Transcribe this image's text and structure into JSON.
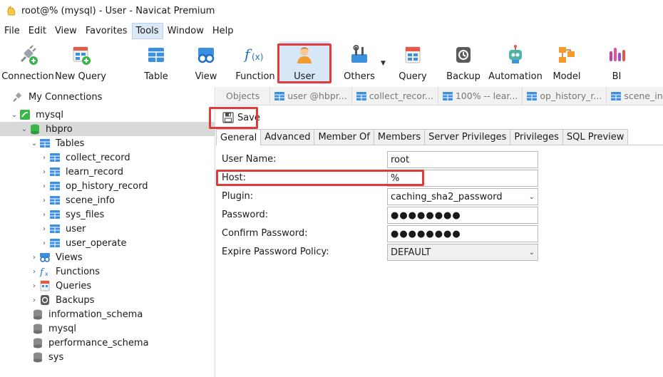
{
  "window": {
    "title": "root@% (mysql) - User - Navicat Premium"
  },
  "menu": [
    "File",
    "Edit",
    "View",
    "Favorites",
    "Tools",
    "Window",
    "Help"
  ],
  "menu_active": "Tools",
  "toolbar": {
    "connection": "Connection",
    "new_query": "New Query",
    "table": "Table",
    "view": "View",
    "function": "Function",
    "user": "User",
    "others": "Others",
    "query": "Query",
    "backup": "Backup",
    "automation": "Automation",
    "model": "Model",
    "bi": "BI"
  },
  "sidebar": {
    "my_connections": "My Connections",
    "connection": "mysql",
    "database": "hbpro",
    "tables_label": "Tables",
    "tables": [
      "collect_record",
      "learn_record",
      "op_history_record",
      "scene_info",
      "sys_files",
      "user",
      "user_operate"
    ],
    "views": "Views",
    "functions": "Functions",
    "queries": "Queries",
    "backups": "Backups",
    "other_dbs": [
      "information_schema",
      "mysql",
      "performance_schema",
      "sys"
    ]
  },
  "doc_tabs": {
    "objects": "Objects",
    "tabs": [
      "user @hbpr...",
      "collect_recor...",
      "100% -- lear...",
      "op_history_r...",
      "scene_info @..."
    ]
  },
  "save_label": "Save",
  "sub_tabs": [
    "General",
    "Advanced",
    "Member Of",
    "Members",
    "Server Privileges",
    "Privileges",
    "SQL Preview"
  ],
  "form": {
    "user_name_label": "User Name:",
    "user_name_value": "root",
    "host_label": "Host:",
    "host_value": "%",
    "plugin_label": "Plugin:",
    "plugin_value": "caching_sha2_password",
    "password_label": "Password:",
    "password_value": "●●●●●●●●",
    "confirm_label": "Confirm Password:",
    "confirm_value": "●●●●●●●●",
    "expire_label": "Expire Password Policy:",
    "expire_value": "DEFAULT"
  },
  "colors": {
    "highlight_red": "#e03a3a",
    "selection_blue": "#d6e8f8",
    "tree_selected": "#d9d9d9"
  }
}
